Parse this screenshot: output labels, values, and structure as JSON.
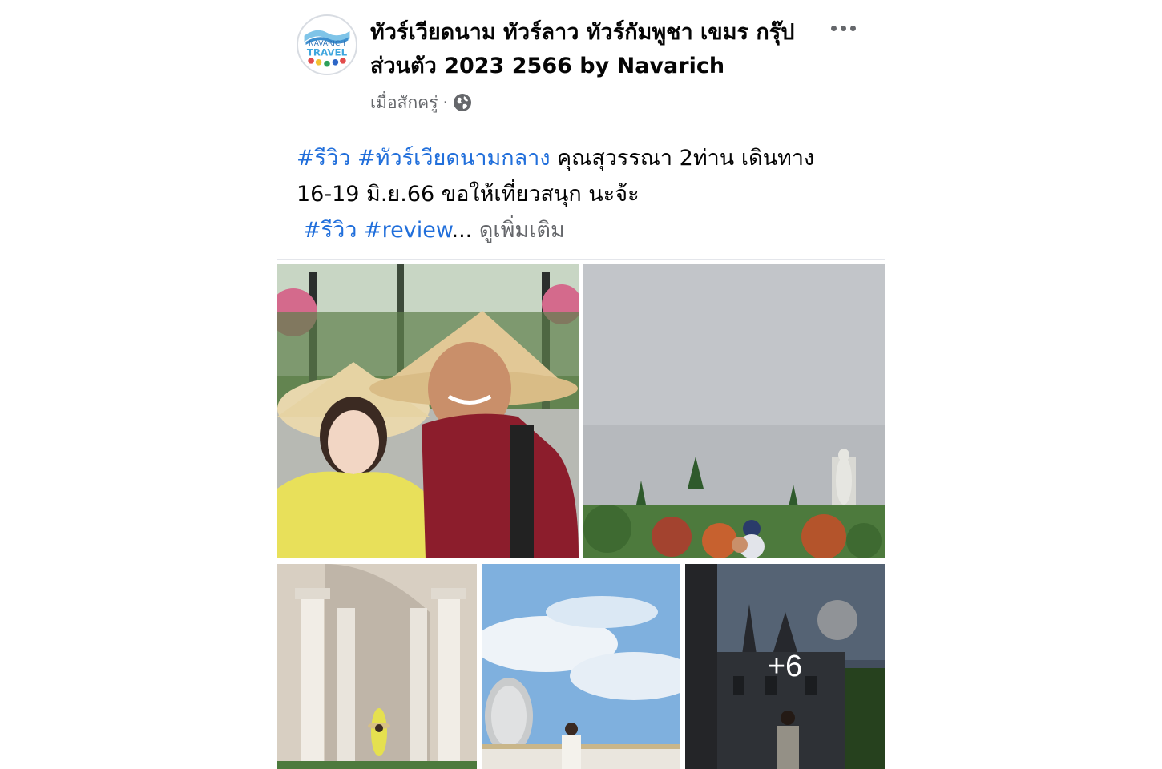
{
  "post": {
    "page_name": "ทัวร์เวียดนาม ทัวร์ลาว ทัวร์กัมพูชา เขมร กรุ๊ปส่วนตัว 2023 2566 by Navarich",
    "time": "เมื่อสักครู่",
    "separator": "·",
    "privacy_icon": "globe-icon",
    "avatar": {
      "line1": "NAVARICH",
      "line2": "TRAVEL"
    },
    "text": {
      "tag1": "#รีวิว",
      "tag2": "#ทัวร์เวียดนามกลาง",
      "line1_rest": " คุณสุวรรณา 2ท่าน เดินทาง",
      "line2": "16-19 มิ.ย.66 ขอให้เที่ยวสนุก นะจ้ะ",
      "tag3": "#รีวิว",
      "tag4": "#review",
      "ellipsis": "...",
      "see_more": "ดูเพิ่มเติม"
    },
    "photos": {
      "more_count": "+6"
    }
  },
  "colors": {
    "hashtag": "#216fdb",
    "secondary_text": "#65676b",
    "primary_text": "#050505"
  }
}
